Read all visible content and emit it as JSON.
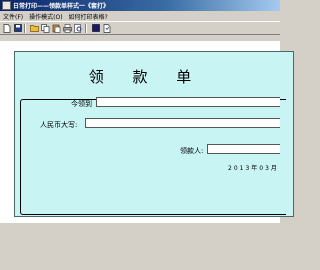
{
  "window": {
    "title": "日常打印——领款单样式一《套打》"
  },
  "menu": {
    "items": [
      "文件(F)",
      "操作模式(O)",
      "如何打印表格?"
    ]
  },
  "toolbar": {
    "icons": [
      "new-icon",
      "save-icon",
      "open-icon",
      "copy-icon",
      "paste-icon",
      "print-icon",
      "print-preview-icon",
      "stop-icon",
      "help-icon"
    ]
  },
  "form": {
    "title": "领 款 单",
    "recipient_label": "今领到",
    "amount_label": "人民币大写:",
    "payee_label": "领款人:",
    "date_text": "2013年03月"
  },
  "colors": {
    "form_background": "#c8f4f4",
    "titlebar": "#0a246a"
  }
}
